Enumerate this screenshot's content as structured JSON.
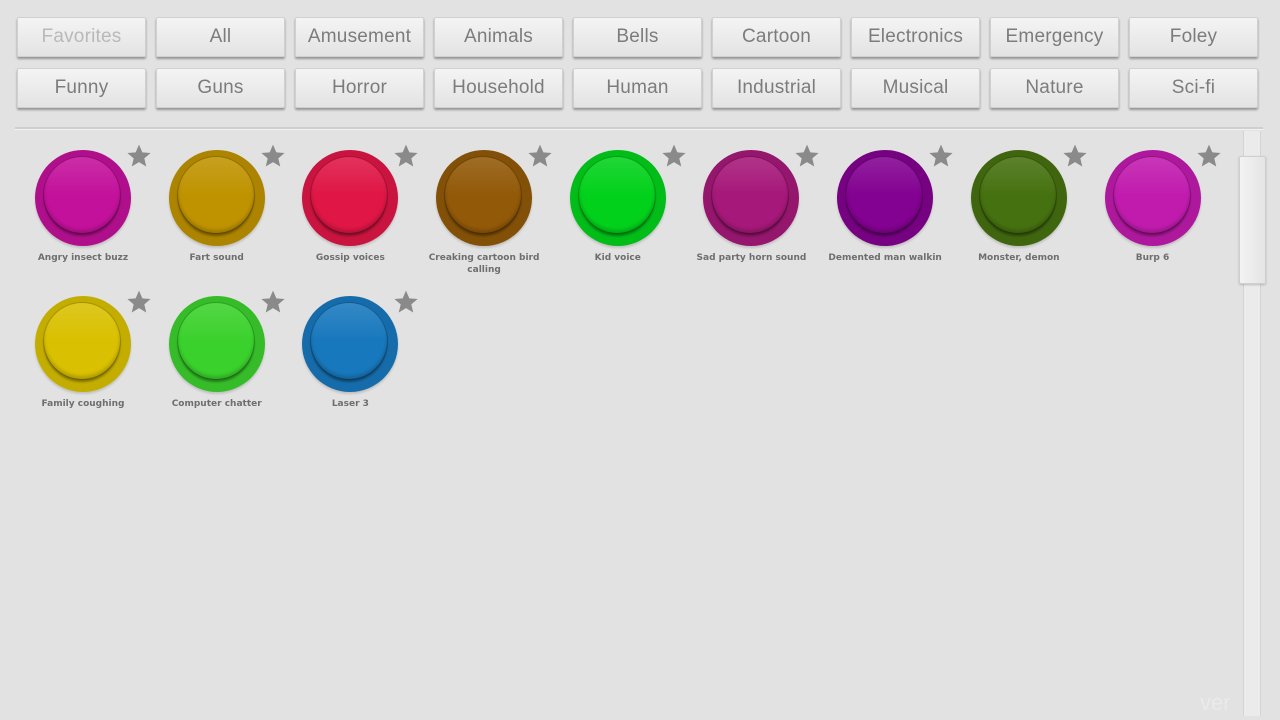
{
  "categories": [
    {
      "label": "Favorites",
      "enabled": false
    },
    {
      "label": "All",
      "enabled": true
    },
    {
      "label": "Amusement",
      "enabled": true
    },
    {
      "label": "Animals",
      "enabled": true
    },
    {
      "label": "Bells",
      "enabled": true
    },
    {
      "label": "Cartoon",
      "enabled": true
    },
    {
      "label": "Electronics",
      "enabled": true
    },
    {
      "label": "Emergency",
      "enabled": true
    },
    {
      "label": "Foley",
      "enabled": true
    },
    {
      "label": "Funny",
      "enabled": true
    },
    {
      "label": "Guns",
      "enabled": true
    },
    {
      "label": "Horror",
      "enabled": true
    },
    {
      "label": "Household",
      "enabled": true
    },
    {
      "label": "Human",
      "enabled": true
    },
    {
      "label": "Industrial",
      "enabled": true
    },
    {
      "label": "Musical",
      "enabled": true
    },
    {
      "label": "Nature",
      "enabled": true
    },
    {
      "label": "Sci-fi",
      "enabled": true
    }
  ],
  "sounds": [
    {
      "label": "Angry insect buzz",
      "color": "#c3119b",
      "icon": "star-icon"
    },
    {
      "label": "Fart sound",
      "color": "#bf9300",
      "icon": "star-icon"
    },
    {
      "label": "Gossip voices",
      "color": "#df1646",
      "icon": "star-icon"
    },
    {
      "label": "Creaking cartoon bird calling",
      "color": "#925908",
      "icon": "star-icon"
    },
    {
      "label": "Kid voice",
      "color": "#02d11b",
      "icon": "star-icon"
    },
    {
      "label": "Sad party horn sound",
      "color": "#a61879",
      "icon": "star-icon"
    },
    {
      "label": "Demented man walkin",
      "color": "#830291",
      "icon": "star-icon"
    },
    {
      "label": "Monster, demon",
      "color": "#467110",
      "icon": "star-icon"
    },
    {
      "label": "Burp 6",
      "color": "#c11bae",
      "icon": "star-icon"
    },
    {
      "label": "Family coughing",
      "color": "#d9c000",
      "icon": "star-icon"
    },
    {
      "label": "Computer chatter",
      "color": "#3bd12c",
      "icon": "star-icon"
    },
    {
      "label": "Laser 3",
      "color": "#1878bd",
      "icon": "star-icon"
    }
  ],
  "colors": {
    "background": "#e2e2e2",
    "button_text": "#7c7c7c",
    "button_text_disabled": "#b9b9b9",
    "star": "#8a8a8a"
  },
  "version_text": "ver"
}
